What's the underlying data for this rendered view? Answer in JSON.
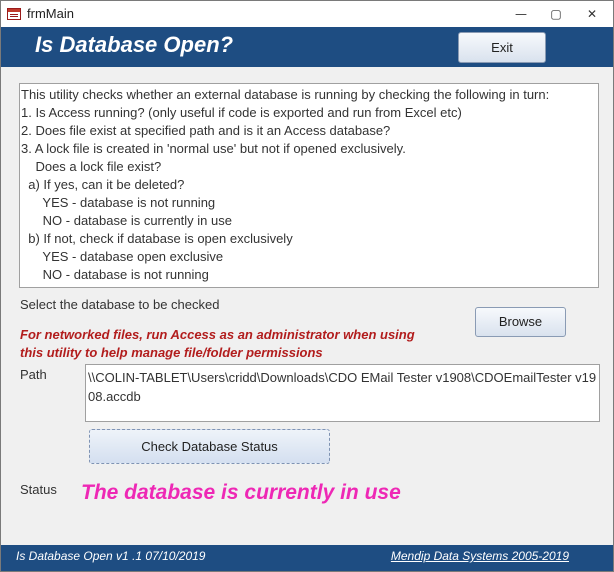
{
  "window": {
    "title": "frmMain",
    "controls": {
      "minimize": "—",
      "maximize": "▢",
      "close": "✕"
    }
  },
  "header": {
    "title": "Is Database Open?",
    "exit_label": "Exit"
  },
  "info": {
    "lines": [
      "This utility checks whether an external database is running by checking the following in turn:",
      "1. Is Access running? (only useful if code is exported and run from Excel etc)",
      "2. Does file exist at specified path and is it an Access database?",
      "3. A lock file is created in 'normal use' but not if opened exclusively.",
      "    Does a lock file exist?",
      "  a) If yes, can it be deleted?",
      "      YES - database is not running",
      "      NO - database is currently in use",
      "  b) If not, check if database is open exclusively",
      "      YES - database open exclusive",
      "      NO - database is not running"
    ]
  },
  "select_label": "Select the database to be checked",
  "browse_label": "Browse",
  "warning": "For networked files, run Access as an administrator when using this utility to help manage file/folder permissions",
  "path": {
    "label": "Path",
    "value": "\\\\COLIN-TABLET\\Users\\cridd\\Downloads\\CDO EMail Tester v1908\\CDOEmailTester v1908.accdb"
  },
  "check_label": "Check Database Status",
  "status": {
    "label": "Status",
    "value": "The database is currently in use"
  },
  "footer": {
    "left": "Is Database Open v1 .1  07/10/2019",
    "right": "Mendip Data Systems 2005-2019"
  },
  "colors": {
    "header_bg": "#1e4d82",
    "status_text": "#ee28b5",
    "warning_text": "#b21d1d"
  }
}
